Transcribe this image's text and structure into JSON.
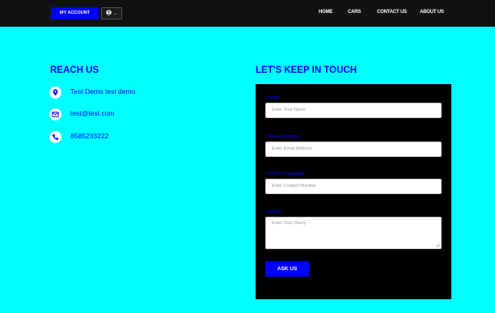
{
  "header": {
    "account_label": "MY ACCOUNT",
    "user_caret": "⌄",
    "nav": [
      {
        "label": "HOME"
      },
      {
        "label": "CARS"
      },
      {
        "label": "CONTACT US"
      },
      {
        "label": "ABOUT US"
      }
    ]
  },
  "reach": {
    "title": "REACH US",
    "address": "Test Demo test demo",
    "email": "test@test.com",
    "phone": "8585233222"
  },
  "form": {
    "title": "LET'S KEEP IN TOUCH",
    "name_label": "* NAME",
    "name_placeholder": "Enter Your Name",
    "email_label": "* EMAIL ADDRESS",
    "email_placeholder": "Enter Email Address",
    "contact_label": "* CONTACT NUMBER",
    "contact_placeholder": "Enter Contact Number",
    "query_label": "* QUERY",
    "query_placeholder": "Enter Your Query",
    "submit_label": "ASK US"
  },
  "colors": {
    "page_bg": "#00FFFF",
    "accent": "#0000FF",
    "topbar_bg": "#111111",
    "form_bg": "#000000"
  },
  "icons": {
    "address": "map-marker-icon",
    "email": "envelope-icon",
    "phone": "phone-icon",
    "user": "user-circle-icon"
  }
}
